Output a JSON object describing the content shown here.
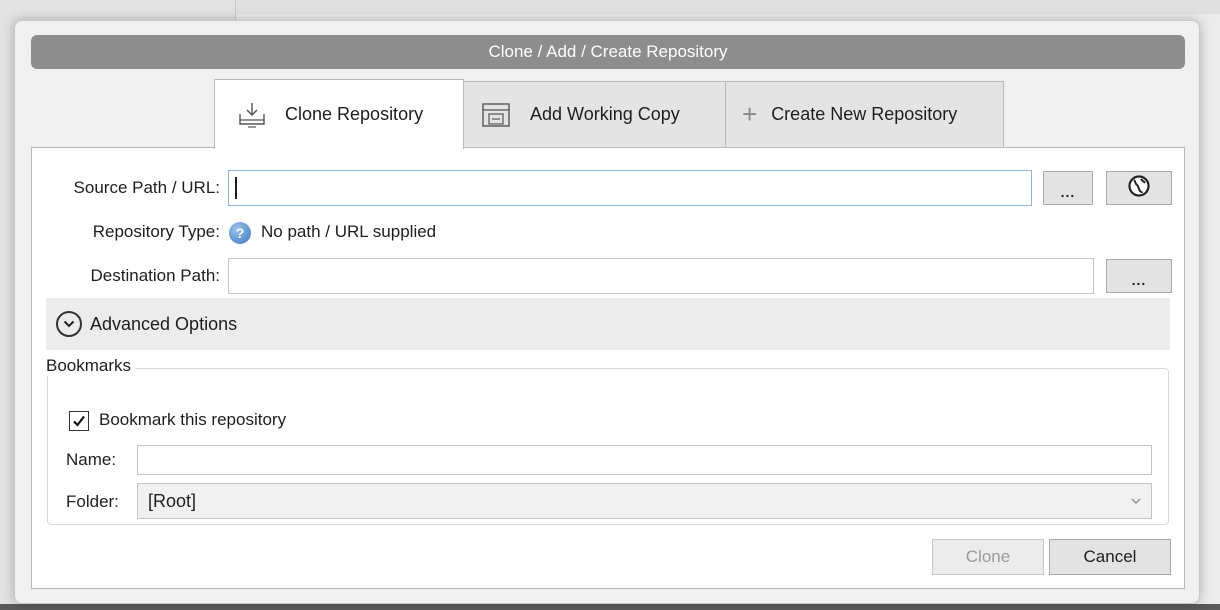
{
  "dialog": {
    "title": "Clone  / Add / Create Repository"
  },
  "tabs": {
    "clone": "Clone Repository",
    "add": "Add Working Copy",
    "create": "Create New Repository"
  },
  "form": {
    "source_label": "Source Path / URL:",
    "source_value": "",
    "browse_label": "...",
    "repo_type_label": "Repository Type:",
    "repo_type_value": "No path / URL supplied",
    "destination_label": "Destination Path:",
    "destination_value": ""
  },
  "advanced": {
    "label": "Advanced Options"
  },
  "bookmarks": {
    "title": "Bookmarks",
    "checkbox_label": "Bookmark this repository",
    "checked": true,
    "name_label": "Name:",
    "name_value": "",
    "folder_label": "Folder:",
    "folder_value": "[Root]"
  },
  "buttons": {
    "clone": "Clone",
    "cancel": "Cancel"
  },
  "icons": {
    "clone_tab": "download-tray-icon",
    "add_tab": "working-copy-folder-icon",
    "create_tab": "plus-icon",
    "remote": "globe-icon",
    "info": "info-icon",
    "advanced": "chevron-down-circle-icon",
    "folder_dropdown": "chevron-down-icon"
  }
}
